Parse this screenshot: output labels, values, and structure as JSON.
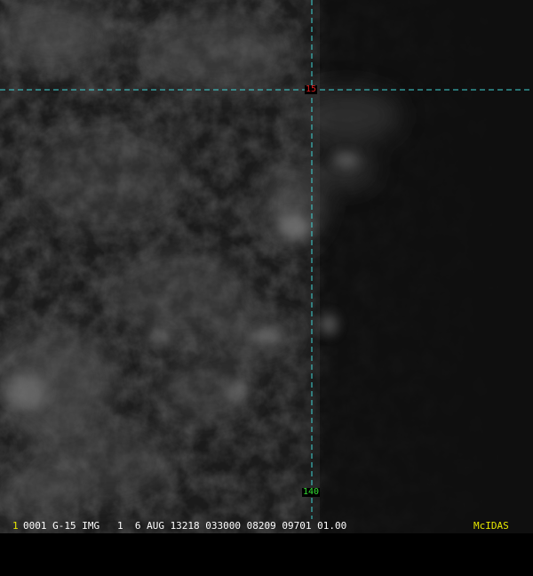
{
  "grid": {
    "latitude_label": "15",
    "longitude_label": "140",
    "grid_color": "#3fd6d6",
    "latitude_label_color": "#e02020",
    "longitude_label_color": "#33e033"
  },
  "status_bar": {
    "frame_number": "1",
    "info": "0001 G-15 IMG   1  6 AUG 13218 033000 08209 09701 01.00",
    "brand": "McIDAS",
    "frame_number_color": "#e8e800",
    "info_color": "#ffffff",
    "brand_color": "#e8e800"
  }
}
